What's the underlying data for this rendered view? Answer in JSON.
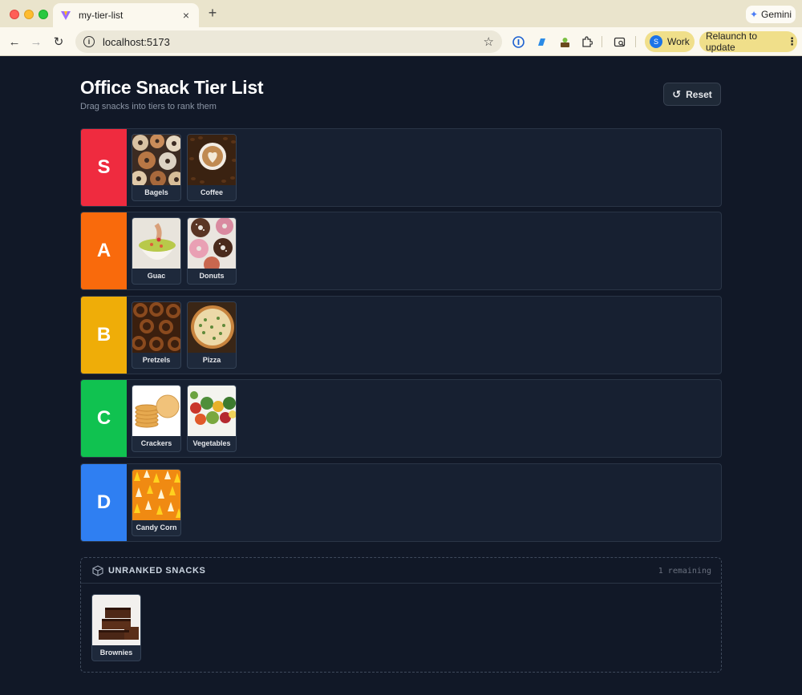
{
  "browser": {
    "tab_title": "my-tier-list",
    "tab_close": "×",
    "new_tab": "+",
    "url": "localhost:5173",
    "gemini_label": "Gemini",
    "profile_label": "Work",
    "profile_initial": "S",
    "relaunch_label": "Relaunch to update"
  },
  "header": {
    "title": "Office Snack Tier List",
    "subtitle": "Drag snacks into tiers to rank them",
    "reset_label": "Reset"
  },
  "tiers": [
    {
      "label": "S",
      "color": "#ef2b3f",
      "items": [
        {
          "name": "Bagels",
          "icon": "bagels-image"
        },
        {
          "name": "Coffee",
          "icon": "coffee-image"
        }
      ]
    },
    {
      "label": "A",
      "color": "#f96a0c",
      "items": [
        {
          "name": "Guac",
          "icon": "guacamole-image"
        },
        {
          "name": "Donuts",
          "icon": "donuts-image"
        }
      ]
    },
    {
      "label": "B",
      "color": "#efad08",
      "items": [
        {
          "name": "Pretzels",
          "icon": "pretzels-image"
        },
        {
          "name": "Pizza",
          "icon": "pizza-image"
        }
      ]
    },
    {
      "label": "C",
      "color": "#10c250",
      "items": [
        {
          "name": "Crackers",
          "icon": "crackers-image"
        },
        {
          "name": "Vegetables",
          "icon": "vegetables-image"
        }
      ]
    },
    {
      "label": "D",
      "color": "#2f7ff2",
      "items": [
        {
          "name": "Candy Corn",
          "icon": "candy-corn-image"
        }
      ]
    }
  ],
  "unranked": {
    "title": "UNRANKED SNACKS",
    "count_text": "1 remaining",
    "items": [
      {
        "name": "Brownies",
        "icon": "brownies-image"
      }
    ]
  }
}
